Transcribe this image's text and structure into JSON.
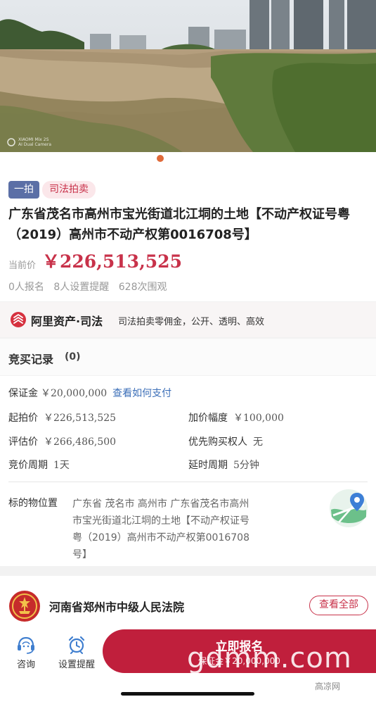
{
  "hero": {
    "image_desc": "vacant land photo",
    "camera_caption_line1": "XIAOMI Mix 2S",
    "camera_caption_line2": "AI Dual Camera"
  },
  "listing": {
    "round_tag": "一拍",
    "type_tag": "司法拍卖",
    "title": "广东省茂名市高州市宝光街道北江垌的土地【不动产权证号粤（2019）高州市不动产权第0016708号】",
    "current_price_label": "当前价",
    "current_price": "￥226,513,525",
    "stats": [
      "0人报名",
      "8人设置提醒",
      "628次围观"
    ]
  },
  "ali": {
    "brand": "阿里资产·司法",
    "slogan": "司法拍卖零佣金，公开、透明、高效",
    "icon": "ali-logo-icon"
  },
  "bid_record": {
    "label": "竞买记录",
    "count": "(0)"
  },
  "details": {
    "deposit_label": "保证金",
    "deposit_value": "￥20,000,000",
    "deposit_link": "查看如何支付",
    "start_price_label": "起拍价",
    "start_price_value": "￥226,513,525",
    "increment_label": "加价幅度",
    "increment_value": "￥100,000",
    "appraisal_label": "评估价",
    "appraisal_value": "￥266,486,500",
    "priority_label": "优先购买权人",
    "priority_value": "无",
    "period_label": "竞价周期",
    "period_value": "1天",
    "delay_label": "延时周期",
    "delay_value": "5分钟",
    "location_label": "标的物位置",
    "location_value": "广东省 茂名市 高州市 广东省茂名市高州市宝光街道北江垌的土地【不动产权证号粤（2019）高州市不动产权第0016708号】",
    "map_icon": "map-pin-icon"
  },
  "court": {
    "name": "河南省郑州市中级人民法院",
    "view_all": "查看全部",
    "emblem": "court-emblem-icon"
  },
  "bottom": {
    "consult_label": "咨询",
    "remind_label": "设置提醒",
    "cta_label": "立即报名",
    "cta_sub": "保证金￥20,000,000"
  },
  "overlay": {
    "watermark": "gdmm.com",
    "source": "高凉网"
  },
  "colors": {
    "accent": "#c8324a",
    "cta": "#c01f3c",
    "tag_blue": "#5b6fa6",
    "link": "#3c6fb8"
  }
}
